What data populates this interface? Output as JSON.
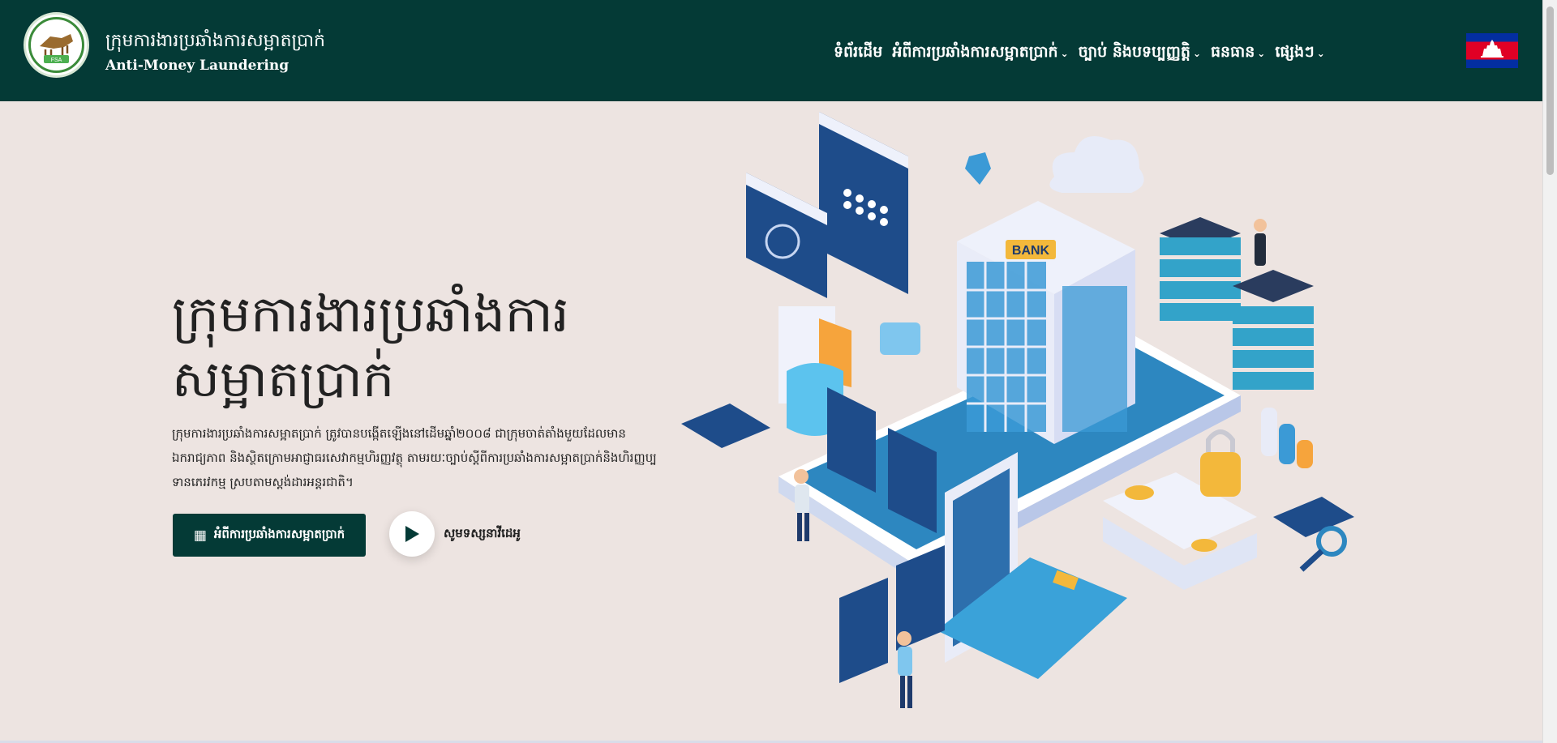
{
  "header": {
    "brand_kh": "ក្រុមការងារប្រឆាំងការសម្អាតប្រាក់",
    "brand_en": "Anti-Money Laundering",
    "logo_text": "FSA"
  },
  "nav": {
    "items": [
      {
        "label": "ទំព័រដើម",
        "icon": "none"
      },
      {
        "label": "អំពីការប្រឆាំងការសម្អាតប្រាក់",
        "icon": "chevron-down-icon"
      },
      {
        "label": "ច្បាប់ និងបទប្បញ្ញត្តិ",
        "icon": "chevron-down-icon"
      },
      {
        "label": "ធនធាន",
        "icon": "chevron-down-icon"
      },
      {
        "label": "ផ្សេងៗ",
        "icon": "chevron-down-icon"
      }
    ],
    "language_flag": "cambodia-flag-icon"
  },
  "hero": {
    "title": "ក្រុមការងារប្រឆាំងការសម្អាតប្រាក់",
    "description": "ក្រុមការងារប្រឆាំងការសម្អាតប្រាក់ ត្រូវបានបង្កើតឡើងនៅដើមឆ្នាំ២០០៨ ជាក្រុមចាត់តាំងមួយដែលមានឯករាជ្យភាព និងស្ថិតក្រោមអាជ្ញាធរសេវាកម្មហិរញ្ញវត្ថុ តាមរយៈច្បាប់ស្តីពីការប្រឆាំងការសម្អាតប្រាក់និងហិរញ្ញប្បទានភេរវកម្ម ស្របតាមស្តង់ដារអន្តរជាតិ។",
    "cta_label": "អំពីការប្រឆាំងការសម្អាតប្រាក់",
    "video_label": "សូមទស្សនាវីដេអូ",
    "illustration_bank_text": "BANK"
  },
  "colors": {
    "brand": "#043a36",
    "background": "#ede4e1",
    "accent": "#1f6fa8"
  }
}
